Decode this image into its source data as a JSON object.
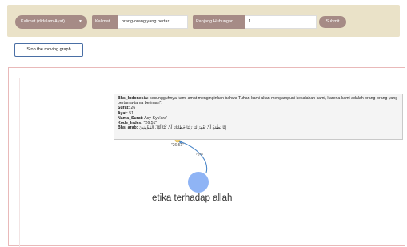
{
  "toolbar": {
    "dropdown_label": "Kalimat (didalam Ayat)",
    "kalimat_label": "Kalimat",
    "kalimat_value": "orang-orang yang pertar",
    "panjang_label": "Panjang Hubungan",
    "panjang_value": "1",
    "submit_label": "Submit"
  },
  "stop_label": "Stop the moving graph",
  "tooltip": {
    "indo_key": "Bhs_Indonesia:",
    "indo_val": "sesungguhnya kami amat menginginkan bahwa Tuhan kami akan mengampuni kesalahan kami, karena kami adalah orang-orang yang pertama-tama beriman\".",
    "surat_key": "Surat:",
    "surat_val": "26",
    "ayat_key": "Ayat:",
    "ayat_val": "51",
    "nama_key": "Nama_Surat:",
    "nama_val": "Asy-Syu'ara'",
    "kode_key": "Kode_Index:",
    "kode_val": "\"26:51\"",
    "arab_key": "Bhs_arab:",
    "arab_val": "إِنَّا نَطْمَعُ أَنْ يَغْفِرَ لَنَا رَبُّنَا خَطَايَانَا أَنْ كُنَّا أَوَّلَ الْمُؤْمِنِينَ"
  },
  "graph": {
    "node_caption": "\"26:51\"",
    "edge_caption": "Ayat",
    "main_label": "etika terhadap allah",
    "node_color": "#8fb4f5",
    "small_node_color": "#f3d27a",
    "edge_color": "#4a86c8"
  }
}
